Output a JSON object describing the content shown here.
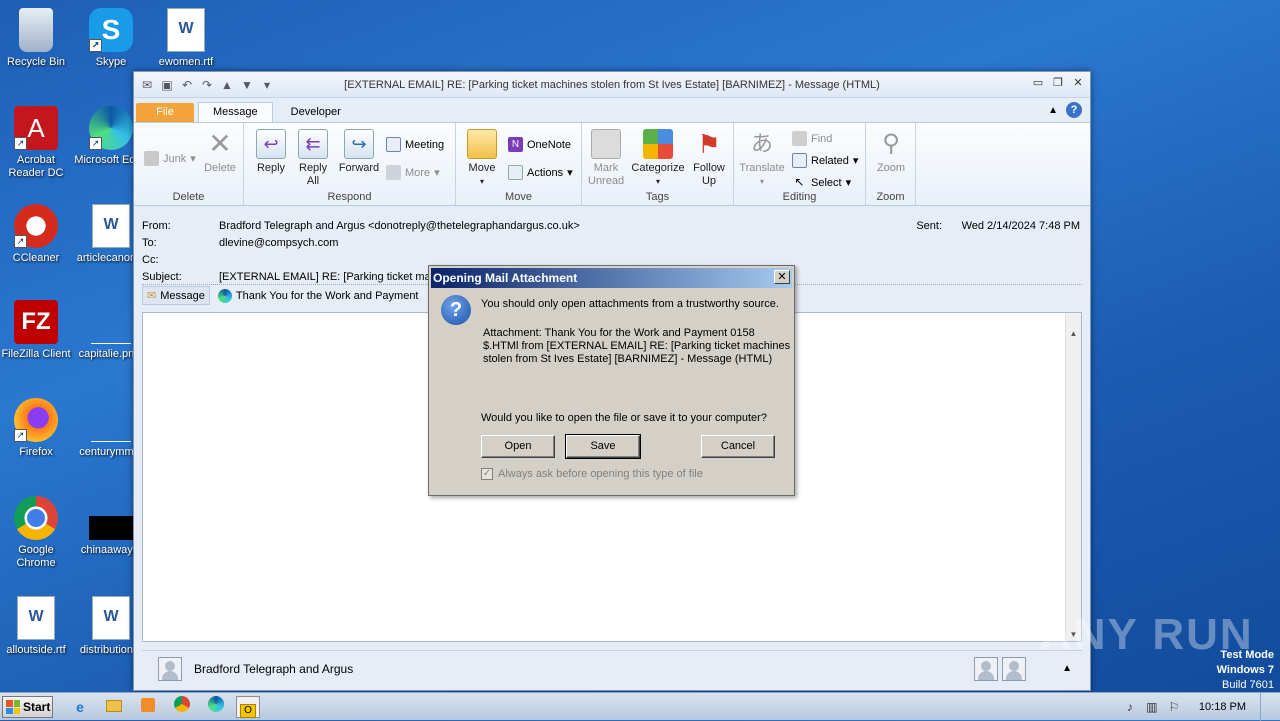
{
  "desktop": {
    "icons": [
      {
        "name": "recycle-bin-icon",
        "label": "Recycle Bin"
      },
      {
        "name": "skype-icon",
        "label": "Skype"
      },
      {
        "name": "word-doc-icon",
        "label": "ewomen.rtf"
      },
      {
        "name": "acrobat-icon",
        "label": "Acrobat Reader DC"
      },
      {
        "name": "edge-icon",
        "label": "Microsoft Edge"
      },
      {
        "name": "ccleaner-icon",
        "label": "CCleaner"
      },
      {
        "name": "word-doc-icon",
        "label": "articlecanon..."
      },
      {
        "name": "filezilla-icon",
        "label": "FileZilla Client"
      },
      {
        "name": "file-icon",
        "label": "capitalie.pn..."
      },
      {
        "name": "firefox-icon",
        "label": "Firefox"
      },
      {
        "name": "file-icon",
        "label": "centurymm..."
      },
      {
        "name": "chrome-icon",
        "label": "Google Chrome"
      },
      {
        "name": "file-icon",
        "label": "chinaaway..."
      },
      {
        "name": "word-doc-icon",
        "label": "alloutside.rtf"
      },
      {
        "name": "word-doc-icon",
        "label": "distribution..."
      }
    ]
  },
  "window": {
    "title": "[EXTERNAL EMAIL] RE: [Parking ticket machines stolen from St Ives Estate] [BARNIMEZ]  -  Message (HTML)",
    "tabs": [
      "File",
      "Message",
      "Developer"
    ]
  },
  "ribbon": {
    "delete": {
      "label": "Delete",
      "junk": "Junk",
      "delete_btn": "Delete"
    },
    "respond": {
      "label": "Respond",
      "reply": "Reply",
      "reply_all": "Reply All",
      "forward": "Forward",
      "meeting": "Meeting",
      "more": "More"
    },
    "move": {
      "label": "Move",
      "move_btn": "Move",
      "onenote": "OneNote",
      "actions": "Actions"
    },
    "tags": {
      "label": "Tags",
      "mark_unread": "Mark Unread",
      "categorize": "Categorize",
      "follow_up": "Follow Up"
    },
    "editing": {
      "label": "Editing",
      "translate": "Translate",
      "find": "Find",
      "related": "Related",
      "select": "Select"
    },
    "zoom": {
      "label": "Zoom",
      "zoom_btn": "Zoom"
    }
  },
  "headers": {
    "from_label": "From:",
    "from": "Bradford Telegraph and Argus <donotreply@thetelegraphandargus.co.uk>",
    "to_label": "To:",
    "to": "dlevine@compsych.com",
    "cc_label": "Cc:",
    "subject_label": "Subject:",
    "subject": "[EXTERNAL EMAIL] RE: [Parking ticket mac",
    "sent_label": "Sent:",
    "sent": "Wed 2/14/2024 7:48 PM"
  },
  "attachments": {
    "message": "Message",
    "file": "Thank You for the Work and Payment"
  },
  "people_pane": {
    "name": "Bradford Telegraph and Argus"
  },
  "dialog": {
    "title": "Opening Mail Attachment",
    "warning": "You should only open attachments from a trustworthy source.",
    "attachment_line1": "Attachment: Thank You for the Work and Payment 0158",
    "attachment_line2": "$.HTMl from [EXTERNAL EMAIL] RE: [Parking ticket machines",
    "attachment_line3": "stolen from St Ives Estate] [BARNIMEZ] - Message (HTML)",
    "question": "Would you like to open the file or save it to your computer?",
    "open": "Open",
    "save": "Save",
    "cancel": "Cancel",
    "always_ask": "Always ask before opening this type of file"
  },
  "taskbar": {
    "start": "Start",
    "time": "10:18 PM"
  },
  "overlay": {
    "watermark": "ANY RUN",
    "test_mode": "Test Mode",
    "os": "Windows 7",
    "build": "Build 7601"
  }
}
